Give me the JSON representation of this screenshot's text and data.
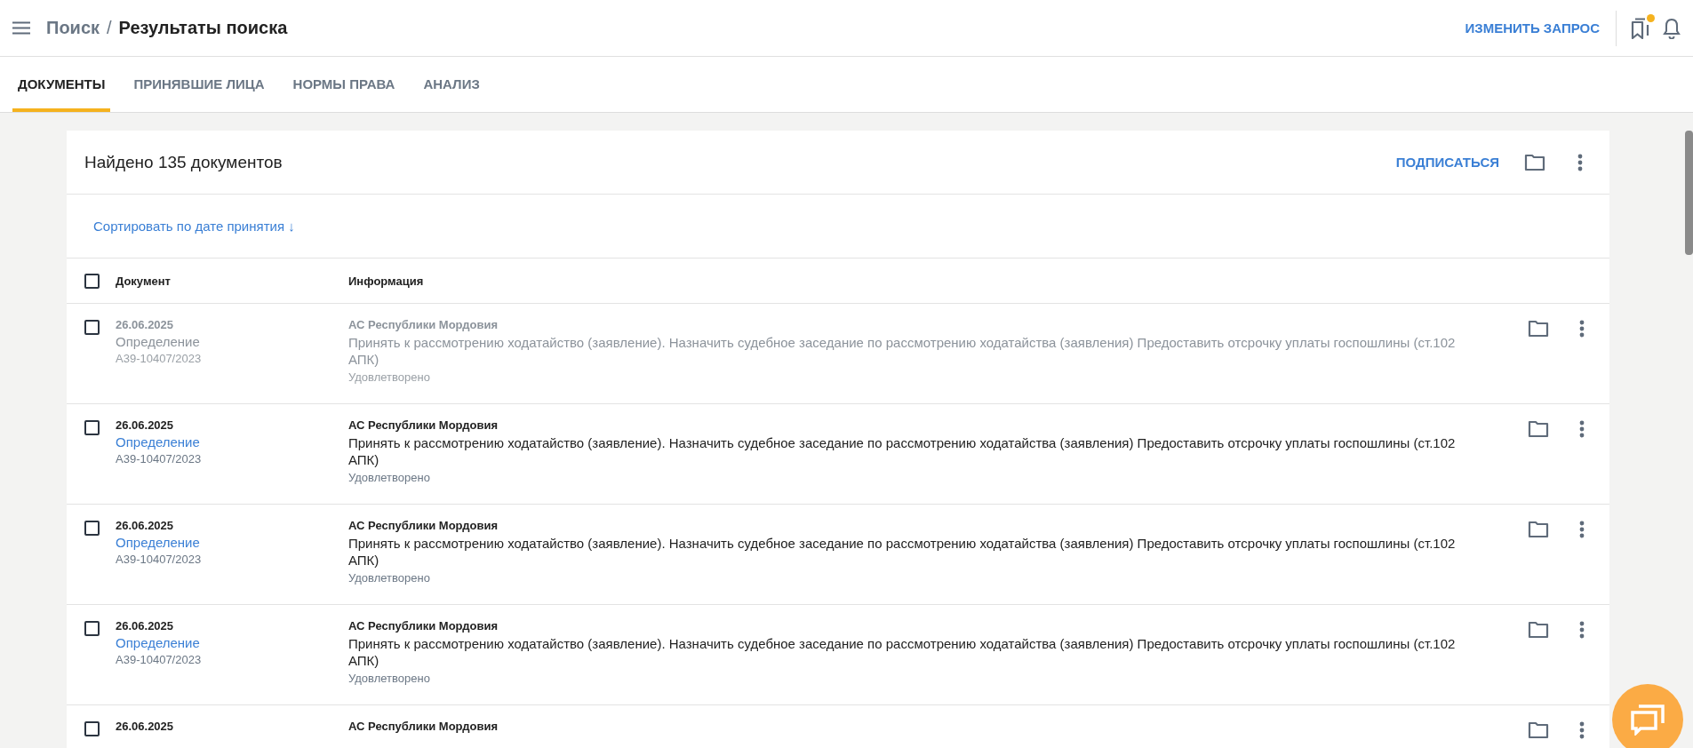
{
  "header": {
    "breadcrumb_parent": "Поиск",
    "separator": "/",
    "title": "Результаты поиска",
    "action": "ИЗМЕНИТЬ ЗАПРОС",
    "bookmarks_badge": true
  },
  "tabs": [
    {
      "label": "ДОКУМЕНТЫ",
      "selected": true
    },
    {
      "label": "ПРИНЯВШИЕ ЛИЦА",
      "selected": false
    },
    {
      "label": "НОРМЫ ПРАВА",
      "selected": false
    },
    {
      "label": "АНАЛИЗ",
      "selected": false
    }
  ],
  "results": {
    "title": "Найдено 135 документов",
    "subscribe": "ПОДПИСАТЬСЯ",
    "sort": "Сортировать по дате принятия ↓",
    "columns": [
      "Документ",
      "Информация"
    ],
    "select_all_checked": false,
    "rows": [
      {
        "viewed": true,
        "checked": false,
        "date": "26.06.2025",
        "type": "Определение",
        "case": "А39-10407/2023",
        "court": "АС Республики Мордовия",
        "text": "Принять к рассмотрению ходатайство (заявление). Назначить судебное заседание по рассмотрению ходатайства (заявления) Предоставить отсрочку уплаты госпошлины (ст.102 АПК)",
        "result": "Удовлетворено"
      },
      {
        "viewed": false,
        "checked": false,
        "date": "26.06.2025",
        "type": "Определение",
        "case": "А39-10407/2023",
        "court": "АС Республики Мордовия",
        "text": "Принять к рассмотрению ходатайство (заявление). Назначить судебное заседание по рассмотрению ходатайства (заявления) Предоставить отсрочку уплаты госпошлины (ст.102 АПК)",
        "result": "Удовлетворено"
      },
      {
        "viewed": false,
        "checked": false,
        "date": "26.06.2025",
        "type": "Определение",
        "case": "А39-10407/2023",
        "court": "АС Республики Мордовия",
        "text": "Принять к рассмотрению ходатайство (заявление). Назначить судебное заседание по рассмотрению ходатайства (заявления) Предоставить отсрочку уплаты госпошлины (ст.102 АПК)",
        "result": "Удовлетворено"
      },
      {
        "viewed": false,
        "checked": false,
        "date": "26.06.2025",
        "type": "Определение",
        "case": "А39-10407/2023",
        "court": "АС Республики Мордовия",
        "text": "Принять к рассмотрению ходатайство (заявление). Назначить судебное заседание по рассмотрению ходатайства (заявления) Предоставить отсрочку уплаты госпошлины (ст.102 АПК)",
        "result": "Удовлетворено"
      },
      {
        "viewed": false,
        "checked": false,
        "date": "26.06.2025",
        "court": "АС Республики Мордовия"
      }
    ]
  }
}
